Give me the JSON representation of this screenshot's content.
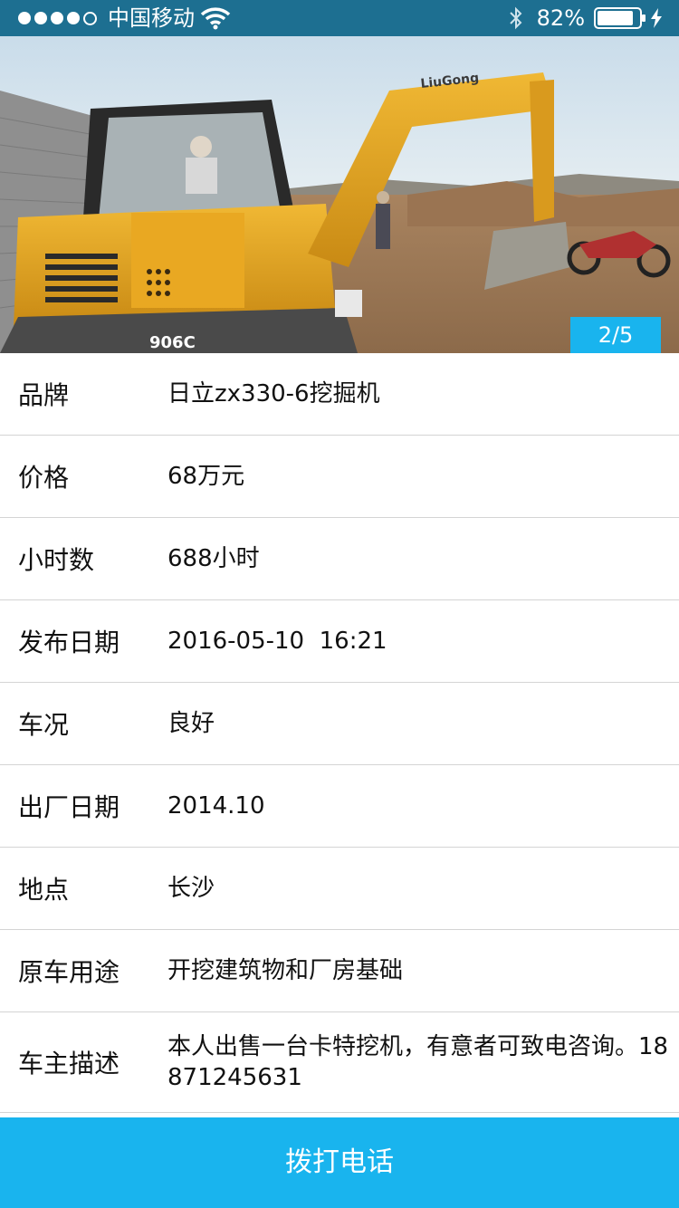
{
  "status_bar": {
    "carrier": "中国移动",
    "battery_percent": "82%",
    "signal_strength": 4,
    "signal_max": 5
  },
  "gallery": {
    "page_indicator": "2/5",
    "brand_decal": "LiuGong",
    "model_decal": "906C"
  },
  "details": [
    {
      "label": "品牌",
      "value": "日立zx330-6挖掘机"
    },
    {
      "label": "价格",
      "value": "68万元"
    },
    {
      "label": "小时数",
      "value": "688小时"
    },
    {
      "label": "发布日期",
      "value": "2016-05-10  16:21"
    },
    {
      "label": "车况",
      "value": "良好"
    },
    {
      "label": "出厂日期",
      "value": "2014.10"
    },
    {
      "label": "地点",
      "value": "长沙"
    },
    {
      "label": "原车用途",
      "value": "开挖建筑物和厂房基础"
    },
    {
      "label": "车主描述",
      "value": "本人出售一台卡特挖机，有意者可致电咨询。18871245631"
    }
  ],
  "call_button_label": "拨打电话",
  "colors": {
    "status_bar_bg": "#1d6f91",
    "accent": "#19b4ee"
  }
}
